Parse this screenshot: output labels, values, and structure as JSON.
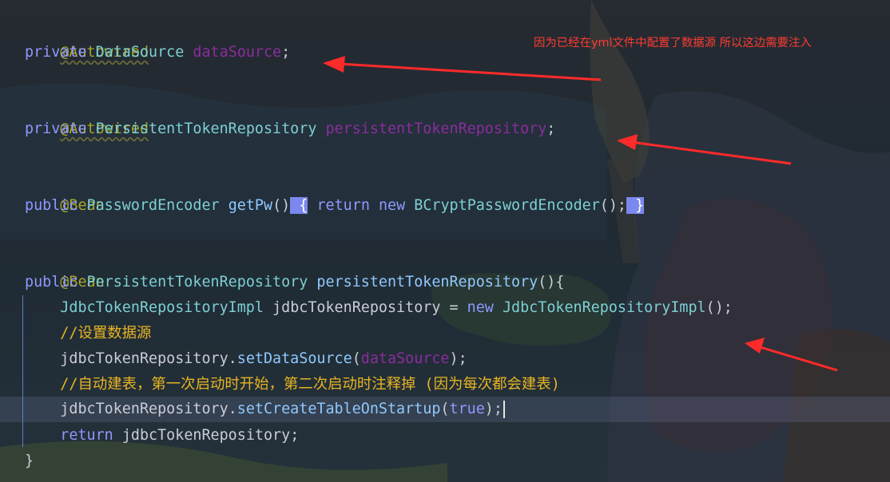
{
  "code": {
    "lines": [
      {
        "text": "@Autowired"
      },
      {
        "text": "private DataSource dataSource;"
      },
      {
        "text": ""
      },
      {
        "text": "@Autowired"
      },
      {
        "text": "private PersistentTokenRepository persistentTokenRepository;"
      },
      {
        "text": ""
      },
      {
        "text": "@Bean"
      },
      {
        "text": "public PasswordEncoder getPw() { return new BCryptPasswordEncoder(); }"
      },
      {
        "text": ""
      },
      {
        "text": "@Bean"
      },
      {
        "text": "public PersistentTokenRepository persistentTokenRepository(){"
      },
      {
        "text": "    JdbcTokenRepositoryImpl jdbcTokenRepository = new JdbcTokenRepositoryImpl();"
      },
      {
        "text": "    //设置数据源"
      },
      {
        "text": "    jdbcTokenRepository.setDataSource(dataSource);"
      },
      {
        "text": "    //自动建表，第一次启动时开始，第二次启动时注释掉 (因为每次都会建表)"
      },
      {
        "text": "    jdbcTokenRepository.setCreateTableOnStartup(true);"
      },
      {
        "text": "    return jdbcTokenRepository;"
      },
      {
        "text": "}"
      }
    ],
    "tokens": {
      "autowired": "@Autowired",
      "bean": "@Bean",
      "private": "private",
      "public": "public",
      "datasource_type": "DataSource",
      "datasource_field": "dataSource",
      "ptr_type": "PersistentTokenRepository",
      "ptr_field": "persistentTokenRepository",
      "pe_type": "PasswordEncoder",
      "getpw": "getPw",
      "parens": "()",
      "open_brace_hl": " {",
      "return": "return",
      "new": "new",
      "bcrypt": "BCryptPasswordEncoder",
      "call_end": "();",
      "close_brace_hl": " }",
      "ptr_method": "persistentTokenRepository",
      "method_open": "(){",
      "impl_type": "JdbcTokenRepositoryImpl",
      "impl_var": "jdbcTokenRepository",
      "equals": "=",
      "comment1": "//设置数据源",
      "set_ds": "setDataSource",
      "comment2": "//自动建表，第一次启动时开始，第二次启动时注释掉 (因为每次都会建表)",
      "set_create": "setCreateTableOnStartup",
      "true_kw": "true",
      "close_brace": "}",
      "semicolon": ";",
      "dot": ".",
      "lparen": "(",
      "rparen_semi": ");",
      "true_close": "(true);"
    }
  },
  "annotation_note": "因为已经在yml文件中配置了数据源 所以这边需要注入",
  "colors": {
    "annotation": "#a6a52c",
    "keyword": "#8f98ff",
    "type": "#7ccfd3",
    "field": "#8b2c9e",
    "comment": "#e6b422",
    "note_text": "#ff3b30",
    "arrow": "#ff2a2a",
    "brace_highlight": "#7b88ee"
  }
}
